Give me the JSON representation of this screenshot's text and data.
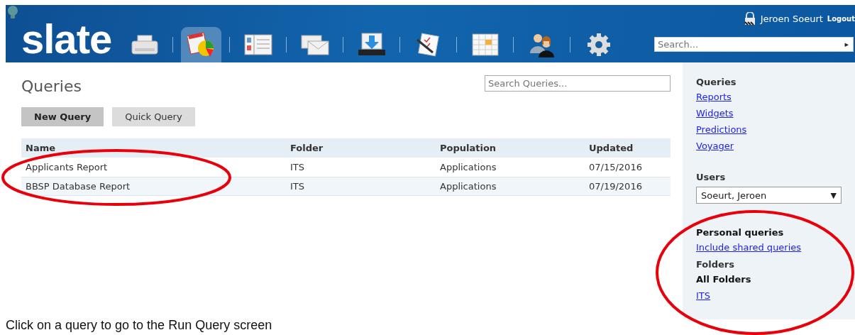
{
  "header": {
    "logo": "slate",
    "user": "Jeroen Soeurt",
    "logout": "Logout",
    "search": {
      "placeholder": "Search..."
    },
    "search_arrow": "▸",
    "nav": [
      {
        "kind": "printer",
        "selected": false
      },
      {
        "kind": "reports",
        "selected": true
      },
      {
        "kind": "form",
        "selected": false
      },
      {
        "kind": "mail",
        "selected": false
      },
      {
        "kind": "inbox",
        "selected": false
      },
      {
        "kind": "checklist",
        "selected": false
      },
      {
        "kind": "calendar",
        "selected": false
      },
      {
        "kind": "people",
        "selected": false
      },
      {
        "kind": "gear",
        "selected": false
      }
    ]
  },
  "main": {
    "title": "Queries",
    "search": {
      "placeholder": "Search Queries..."
    },
    "buttons": [
      {
        "label": "New Query",
        "selected": true
      },
      {
        "label": "Quick Query",
        "selected": false
      }
    ],
    "table": {
      "circled": true,
      "columns": [
        "Name",
        "Folder",
        "Population",
        "Updated"
      ],
      "rows": [
        [
          "Applicants Report",
          "ITS",
          "Applications",
          "07/15/2016"
        ],
        [
          "BBSP Database Report",
          "ITS",
          "Applications",
          "07/19/2016"
        ]
      ]
    }
  },
  "sidebar": {
    "queries": {
      "heading": "Queries",
      "links": [
        "Reports",
        "Widgets",
        "Predictions",
        "Voyager"
      ]
    },
    "users": {
      "heading": "Users",
      "value": "Soeurt, Jeroen",
      "arrow": "▼"
    },
    "circled": true,
    "personal": {
      "heading": "Personal queries",
      "link": "Include shared queries"
    },
    "folders": {
      "heading": "Folders",
      "items": [
        {
          "label": "All Folders",
          "selected": true
        },
        {
          "label": "ITS",
          "selected": false
        }
      ]
    }
  },
  "caption": "Click on a query to go to the Run Query screen"
}
